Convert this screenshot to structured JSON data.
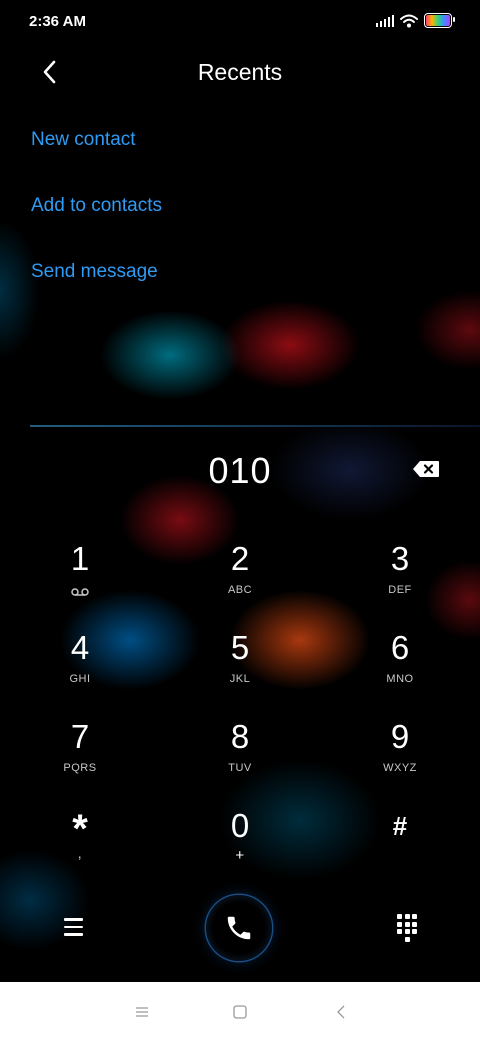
{
  "status_bar": {
    "time": "2:36 AM",
    "icons": [
      "signal-icon",
      "wifi-icon",
      "battery-icon"
    ]
  },
  "header": {
    "title": "Recents",
    "back_icon": "chevron-left-icon"
  },
  "actions": [
    {
      "label": "New contact"
    },
    {
      "label": "Add to contacts"
    },
    {
      "label": "Send message"
    }
  ],
  "dialer": {
    "number": "010",
    "backspace_icon": "backspace-icon",
    "keys": [
      {
        "digit": "1",
        "letters": "",
        "icon": "voicemail-icon"
      },
      {
        "digit": "2",
        "letters": "ABC"
      },
      {
        "digit": "3",
        "letters": "DEF"
      },
      {
        "digit": "4",
        "letters": "GHI"
      },
      {
        "digit": "5",
        "letters": "JKL"
      },
      {
        "digit": "6",
        "letters": "MNO"
      },
      {
        "digit": "7",
        "letters": "PQRS"
      },
      {
        "digit": "8",
        "letters": "TUV"
      },
      {
        "digit": "9",
        "letters": "WXYZ"
      },
      {
        "digit": "*",
        "letters": ","
      },
      {
        "digit": "0",
        "letters": "+"
      },
      {
        "digit": "#",
        "letters": ""
      }
    ]
  },
  "bottom_actions": {
    "menu_icon": "menu-icon",
    "call_icon": "phone-icon",
    "dialpad_icon": "dialpad-icon"
  },
  "nav_bar": {
    "items": [
      "recents-nav-icon",
      "home-nav-icon",
      "back-nav-icon"
    ]
  },
  "colors": {
    "accent": "#2f9bf3",
    "text": "#ffffff",
    "background": "#000000",
    "nav_bar": "#ffffff"
  }
}
